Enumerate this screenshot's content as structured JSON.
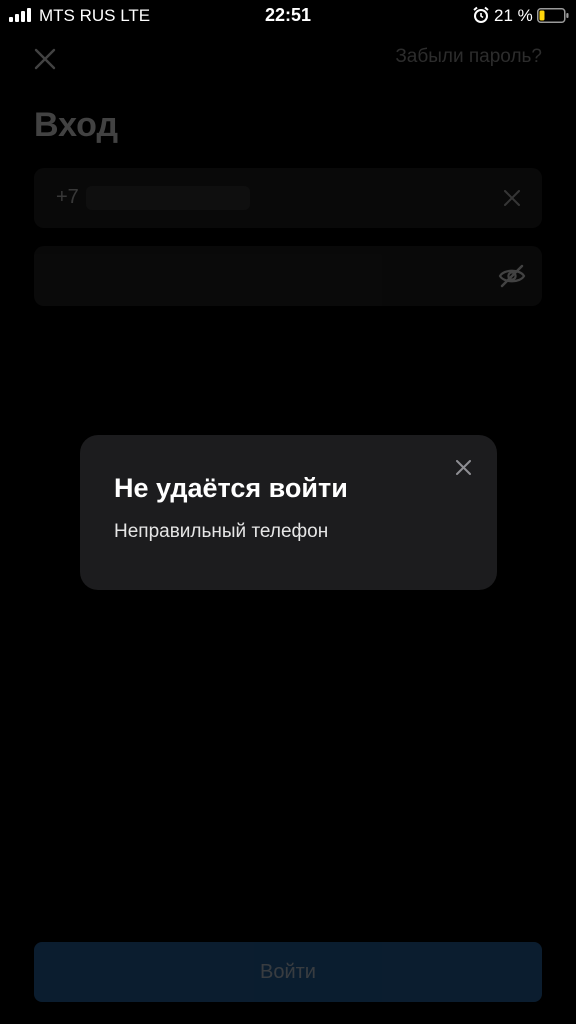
{
  "status_bar": {
    "carrier": "MTS RUS   LTE",
    "time": "22:51",
    "battery_percent": "21 %",
    "alarm_icon": "alarm-clock-icon",
    "battery_icon": "battery-low-icon",
    "battery_level": 0.21,
    "battery_color": "#ffd60a"
  },
  "login_screen": {
    "close_icon": "close-icon",
    "forgot_password": "Забыли пароль?",
    "title": "Вход",
    "phone_field": {
      "prefix": "+7",
      "clear_icon": "clear-icon"
    },
    "password_field": {
      "visibility_icon": "eye-off-icon"
    },
    "login_button": "Войти",
    "login_button_color": "#2a6fb5"
  },
  "dialog": {
    "title": "Не удаётся войти",
    "message": "Неправильный телефон",
    "close_icon": "close-icon"
  }
}
